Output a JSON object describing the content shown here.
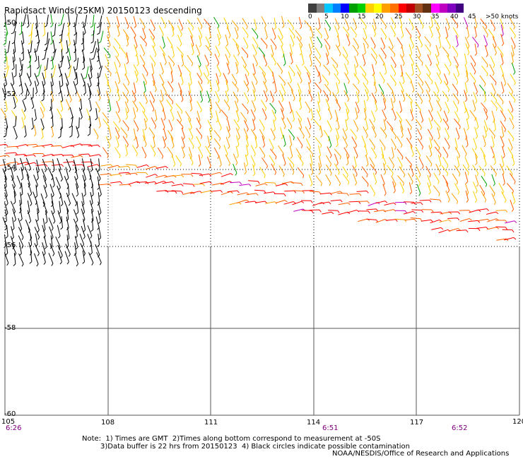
{
  "title": "Rapidsact Winds(25KM) 20150123 descending",
  "legend": {
    "labels": [
      "0",
      "5",
      "10",
      "15",
      "20",
      "25",
      "30",
      "35",
      "40",
      "45",
      ">50 knots"
    ],
    "colors": [
      "#404040",
      "#808080",
      "#00c8ff",
      "#0080ff",
      "#0000ff",
      "#00a000",
      "#00d000",
      "#ffd000",
      "#ffff00",
      "#ffa000",
      "#ff7000",
      "#ff0000",
      "#c00000",
      "#a05020",
      "#603010",
      "#ff00ff",
      "#c000c0",
      "#8000c0",
      "#400080"
    ]
  },
  "lat_labels": [
    "-50",
    "-52",
    "-54",
    "-56",
    "-58",
    "-60"
  ],
  "lon_labels": [
    "105",
    "108",
    "111",
    "114",
    "117",
    "120"
  ],
  "time_labels": [
    "6:26",
    "6:51",
    "6:52"
  ],
  "notes": [
    "Note:  1) Times are GMT  2)Times along bottom correspond to measurement at -50S",
    "3)Data buffer is 22 hrs from 20150123  4) Black circles indicate possible contamination"
  ],
  "credit": "NOAA/NESDIS/Office of Research and Applications",
  "barb_colors": {
    "old": "#000000",
    "light": "#00a000",
    "moderate": "#ffd000",
    "fresh": "#ffa000",
    "strong": "#ff6000",
    "gale": "#ff0000",
    "storm": "#c000c0"
  }
}
